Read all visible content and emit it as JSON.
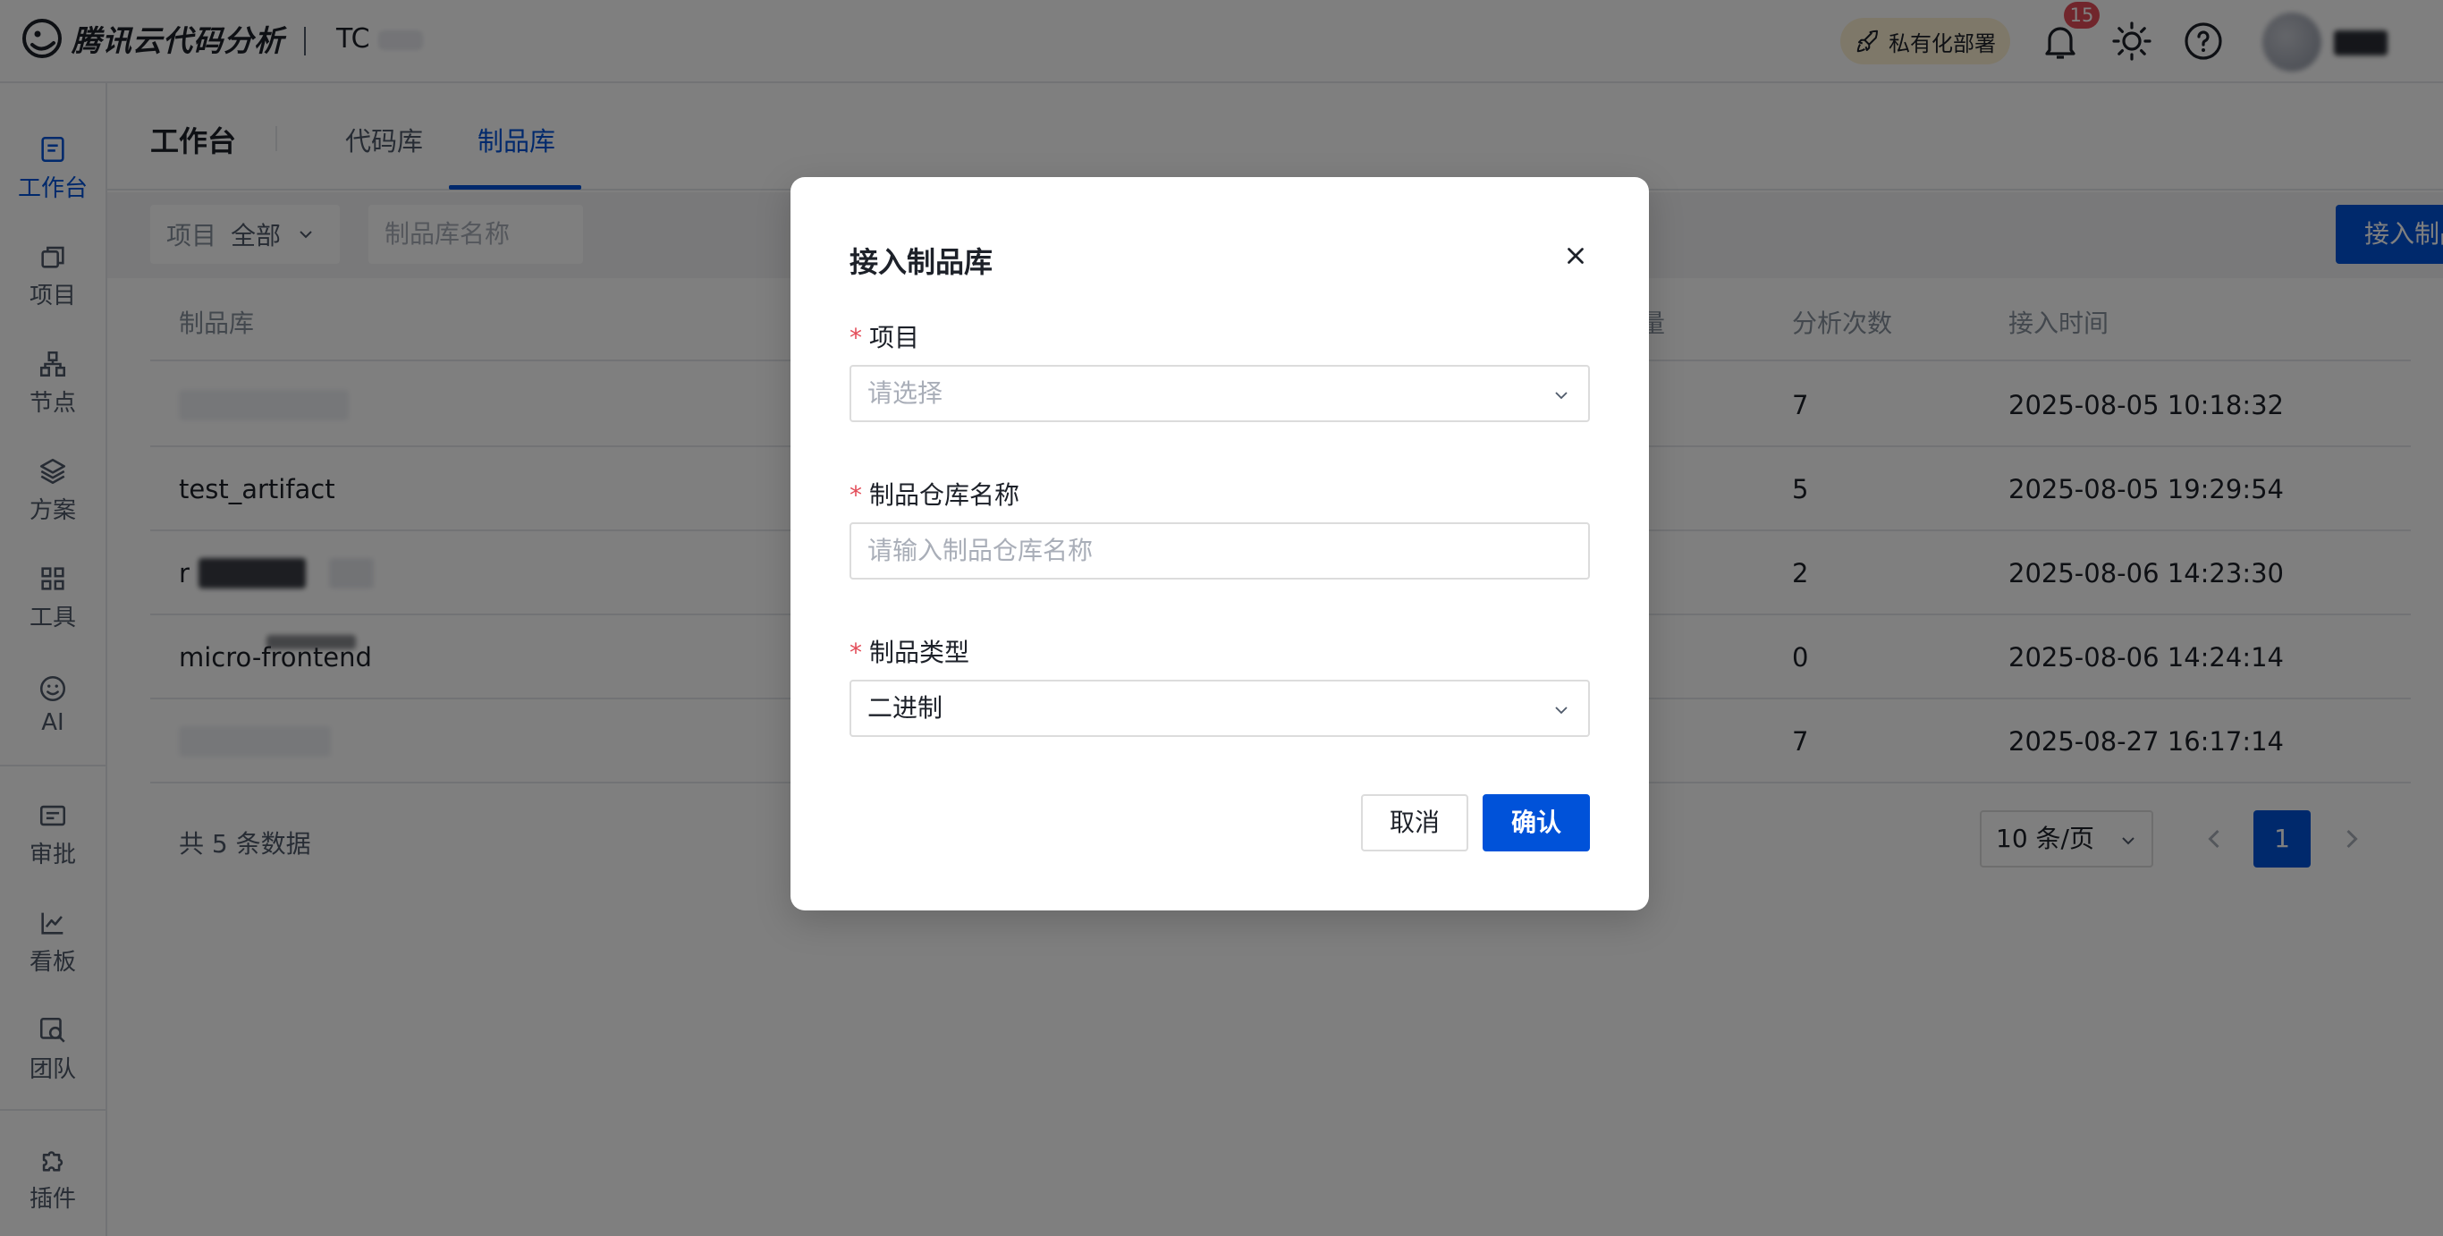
{
  "app": {
    "brand": "腾讯云代码分析",
    "team": "TC",
    "deploy_label": "私有化部署",
    "notification_count": "15"
  },
  "sidebar": {
    "items": [
      {
        "label": "工作台",
        "icon": "workbench-icon",
        "active": true
      },
      {
        "label": "项目",
        "icon": "project-icon"
      },
      {
        "label": "节点",
        "icon": "node-icon"
      },
      {
        "label": "方案",
        "icon": "layers-icon"
      },
      {
        "label": "工具",
        "icon": "grid-icon"
      },
      {
        "label": "AI",
        "icon": "smile-icon"
      },
      {
        "label": "审批",
        "icon": "list-icon"
      },
      {
        "label": "看板",
        "icon": "chart-line-icon"
      },
      {
        "label": "团队",
        "icon": "team-search-icon"
      },
      {
        "label": "插件",
        "icon": "puzzle-icon"
      }
    ]
  },
  "header": {
    "title": "工作台",
    "tabs": [
      {
        "label": "代码库"
      },
      {
        "label": "制品库",
        "active": true
      }
    ]
  },
  "filters": {
    "project_label": "项目",
    "project_value": "全部",
    "search_placeholder": "制品库名称",
    "add_button": "接入制品库"
  },
  "table": {
    "headers": [
      "制品库",
      "量",
      "分析次数",
      "接入时间"
    ],
    "rows": [
      {
        "name": "",
        "count": "7",
        "time": "2025-08-05 10:18:32"
      },
      {
        "name": "test_artifact",
        "count": "5",
        "time": "2025-08-05 19:29:54"
      },
      {
        "name": "r",
        "count": "2",
        "time": "2025-08-06 14:23:30"
      },
      {
        "name": "micro-frontend",
        "count": "0",
        "time": "2025-08-06 14:24:14"
      },
      {
        "name": "",
        "count": "7",
        "time": "2025-08-27 16:17:14"
      }
    ]
  },
  "pagination": {
    "total": "共 5 条数据",
    "page_size": "10 条/页",
    "current_page": "1"
  },
  "modal": {
    "title": "接入制品库",
    "fields": [
      {
        "label": "项目",
        "placeholder": "请选择",
        "value": ""
      },
      {
        "label": "制品仓库名称",
        "placeholder": "请输入制品仓库名称",
        "value": ""
      },
      {
        "label": "制品类型",
        "placeholder": "",
        "value": "二进制"
      }
    ],
    "cancel": "取消",
    "confirm": "确认"
  },
  "colors": {
    "primary": "#0052d9",
    "danger": "#e34d59"
  }
}
